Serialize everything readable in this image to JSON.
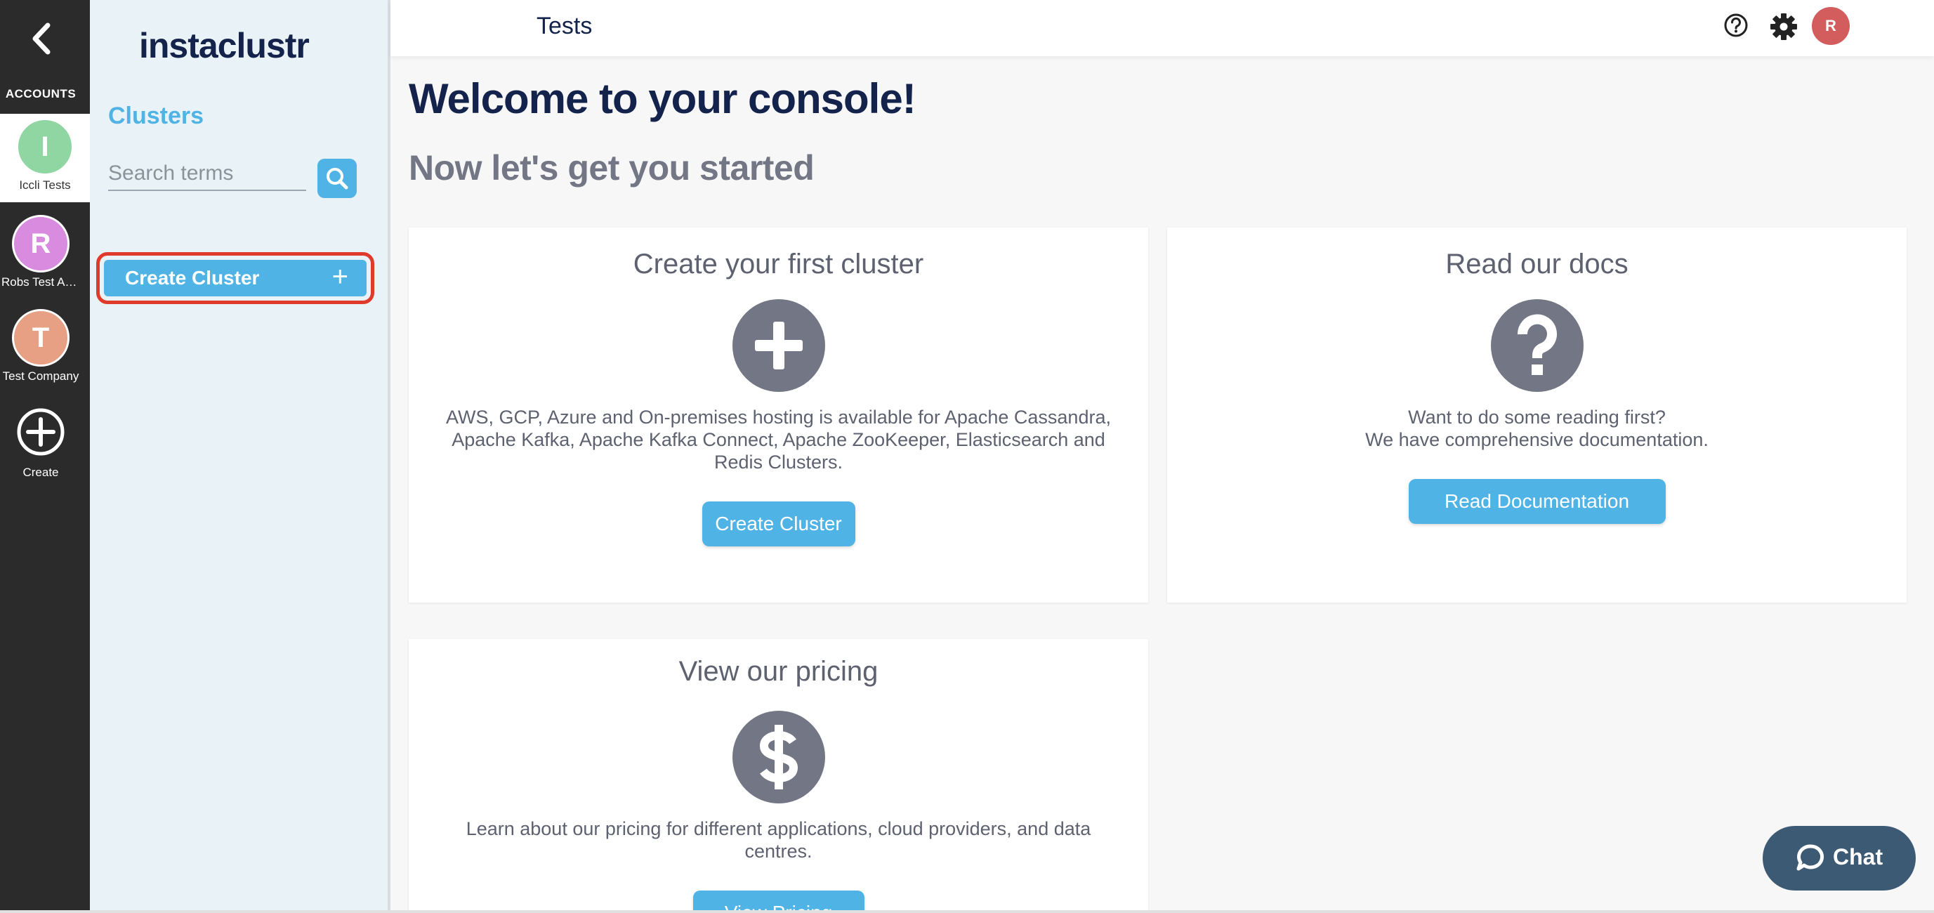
{
  "rail": {
    "accounts_label": "ACCOUNTS",
    "accounts": [
      {
        "initial": "I",
        "name": "Iccli Tests",
        "color": "#8fd6a3",
        "active": true
      },
      {
        "initial": "R",
        "name": "Robs Test Ac...",
        "color": "#d98be0",
        "active": false
      },
      {
        "initial": "T",
        "name": "Test Company",
        "color": "#e7a084",
        "active": false
      }
    ],
    "create_label": "Create"
  },
  "sidebar": {
    "logo": "instaclustr",
    "clusters_title": "Clusters",
    "search_placeholder": "Search terms",
    "create_cluster_label": "Create Cluster",
    "create_cluster_plus": "+"
  },
  "header": {
    "title": "Tests",
    "avatar_initial": "R"
  },
  "main": {
    "welcome": "Welcome to your console!",
    "subtitle": "Now let's get you started",
    "cards": {
      "cluster": {
        "title": "Create your first cluster",
        "body": "AWS, GCP, Azure and On-premises hosting is available for Apache Cassandra, Apache Kafka, Apache Kafka Connect, Apache ZooKeeper, Elasticsearch and Redis Clusters.",
        "button": "Create Cluster"
      },
      "docs": {
        "title": "Read our docs",
        "body_line1": "Want to do some reading first?",
        "body_line2": "We have comprehensive documentation.",
        "button": "Read Documentation"
      },
      "pricing": {
        "title": "View our pricing",
        "body": "Learn about our pricing for different applications, cloud providers, and data centres.",
        "button": "View Pricing"
      }
    }
  },
  "chat": {
    "label": "Chat"
  },
  "colors": {
    "accent": "#4fb3e6",
    "navy": "#14234b",
    "highlight": "#e03a2a",
    "rail": "#2b2b2b",
    "icon_gray": "#737785"
  }
}
